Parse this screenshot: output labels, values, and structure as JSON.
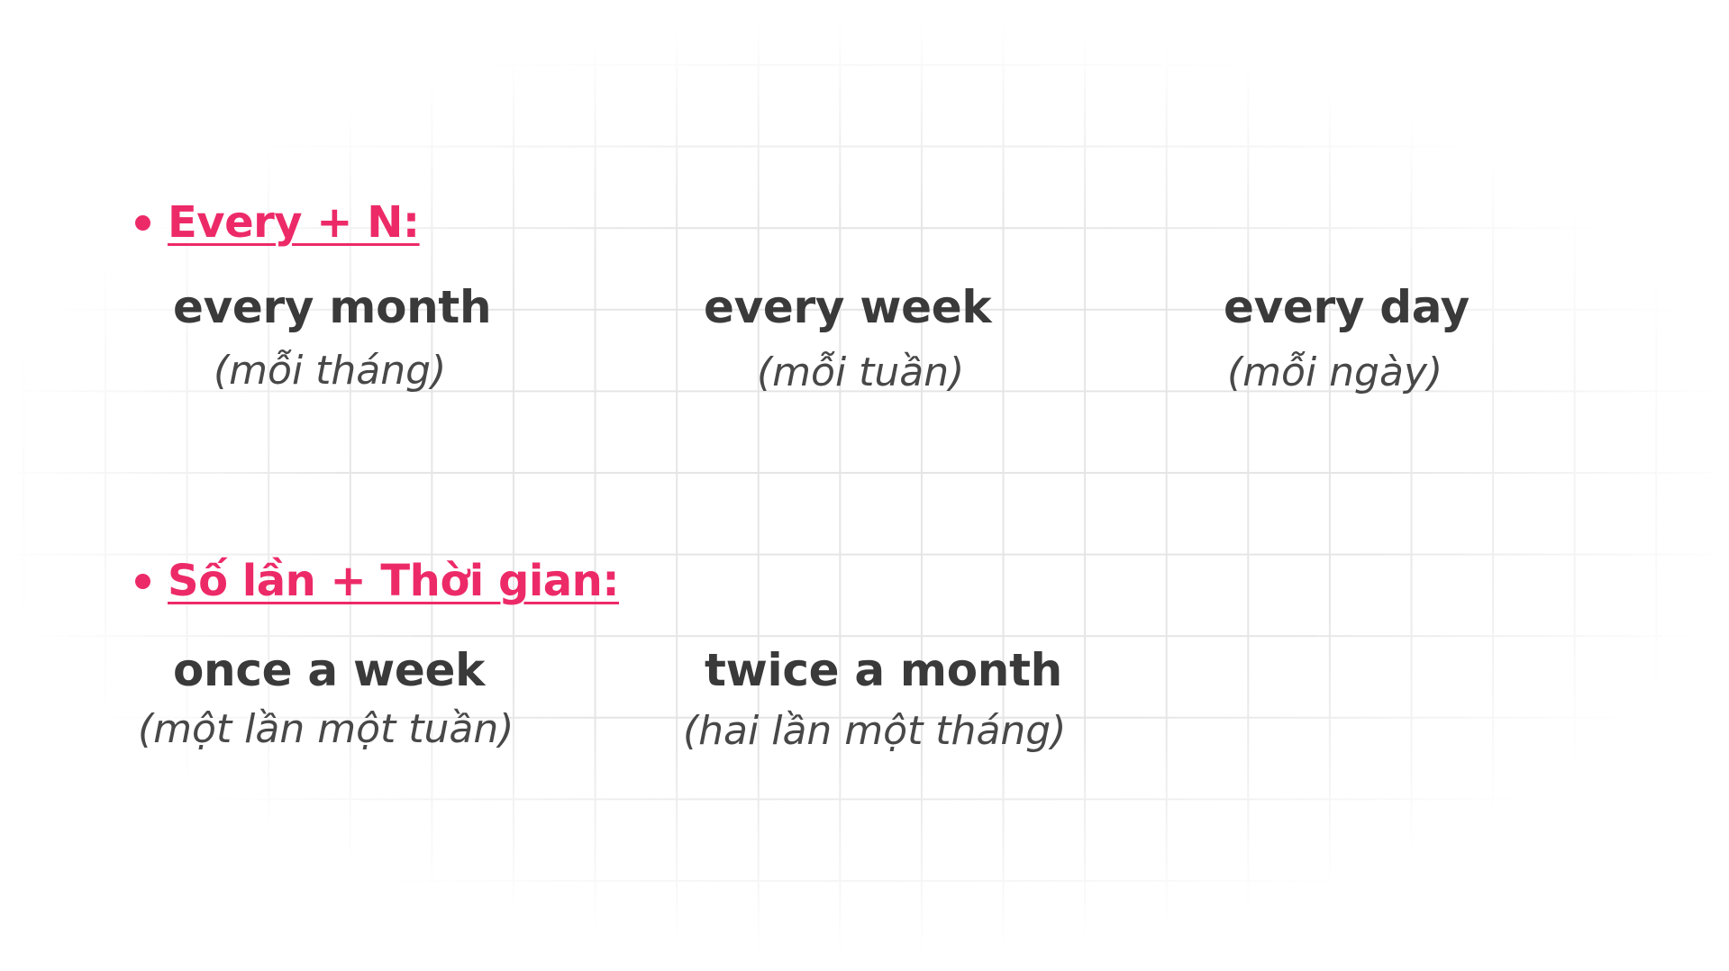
{
  "colors": {
    "accent": "#ed2a68",
    "term_text": "#3a3a3a",
    "translation_text": "#484848",
    "background": "#ffffff",
    "grid_line": "#e4e4e4"
  },
  "sections": [
    {
      "heading": "Every + N:",
      "items": [
        {
          "term": "every month",
          "translation": "(mỗi tháng)"
        },
        {
          "term": "every week",
          "translation": "(mỗi tuần)"
        },
        {
          "term": "every day",
          "translation": "(mỗi ngày)"
        }
      ]
    },
    {
      "heading": "Số lần + Thời gian:",
      "items": [
        {
          "term": "once a week",
          "translation": "(một lần một tuần)"
        },
        {
          "term": "twice a month",
          "translation": "(hai lần một tháng)"
        }
      ]
    }
  ]
}
